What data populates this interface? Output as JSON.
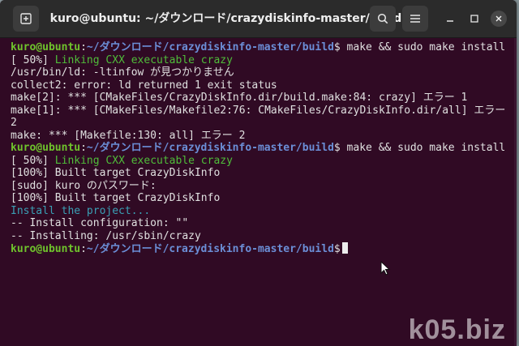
{
  "window": {
    "title": "kuro@ubuntu: ~/ダウンロード/crazydiskinfo-master/build"
  },
  "titlebar": {
    "buttons": {
      "new_tab": "new-tab-icon",
      "search": "search-icon",
      "menu": "hamburger-menu-icon",
      "minimize": "minimize-icon",
      "maximize": "maximize-icon",
      "close": "close-icon"
    }
  },
  "prompt": {
    "user_host": "kuro@ubuntu",
    "sep": ":",
    "path": "~/ダウンロード/crazydiskinfo-master/build",
    "dollar": "$"
  },
  "terminal": {
    "cmd1": " make && sudo make install",
    "l1": "[ 50%] ",
    "l1b": "Linking CXX executable crazy",
    "l2": "/usr/bin/ld: -ltinfow が見つかりません",
    "l3": "collect2: error: ld returned 1 exit status",
    "l4": "make[2]: *** [CMakeFiles/CrazyDiskInfo.dir/build.make:84: crazy] エラー 1",
    "l5": "make[1]: *** [CMakeFiles/Makefile2:76: CMakeFiles/CrazyDiskInfo.dir/all] エラー",
    "l5b": "2",
    "l6": "make: *** [Makefile:130: all] エラー 2",
    "cmd2": " make && sudo make install",
    "l7": "[ 50%] ",
    "l7b": "Linking CXX executable crazy",
    "l8": "[100%] Built target CrazyDiskInfo",
    "l9": "[sudo] kuro のパスワード:",
    "l10": "[100%] Built target CrazyDiskInfo",
    "l11": "Install the project...",
    "l12": "-- Install configuration: \"\"",
    "l13": "-- Installing: /usr/sbin/crazy"
  },
  "watermark": "k05.biz"
}
